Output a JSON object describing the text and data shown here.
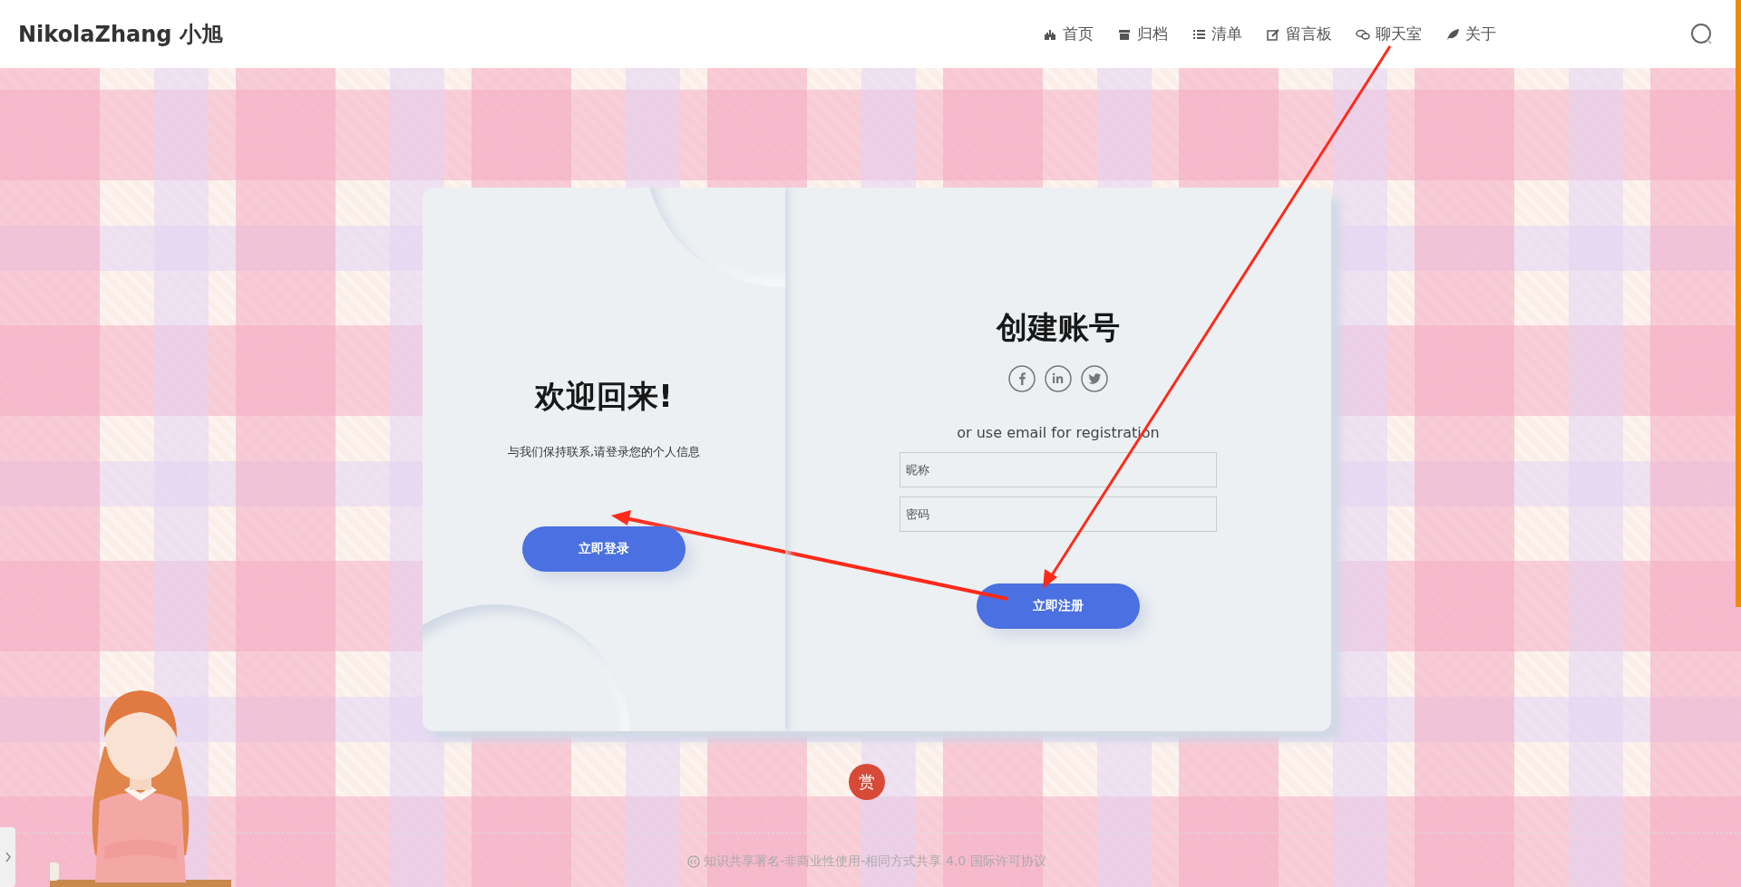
{
  "header": {
    "logo": "NikolaZhang 小旭",
    "nav": [
      {
        "label": "首页"
      },
      {
        "label": "归档"
      },
      {
        "label": "清单"
      },
      {
        "label": "留言板"
      },
      {
        "label": "聊天室"
      },
      {
        "label": "关于"
      }
    ]
  },
  "login_panel": {
    "title": "欢迎回来!",
    "text": "与我们保持联系,请登录您的个人信息",
    "button": "立即登录"
  },
  "register_panel": {
    "title": "创建账号",
    "hint": "or use email for registration",
    "fields": [
      {
        "placeholder": "昵称"
      },
      {
        "placeholder": "密码"
      }
    ],
    "button": "立即注册"
  },
  "reward_badge": "赏",
  "footer": {
    "license": "知识共享署名-非商业性使用-相同方式共享 4.0 国际许可协议"
  }
}
